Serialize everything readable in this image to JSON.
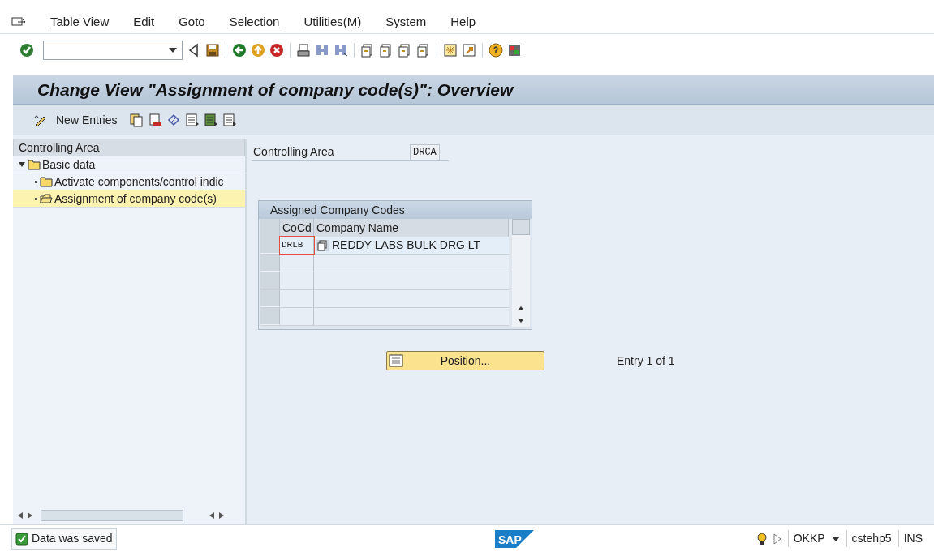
{
  "menu": [
    "Table View",
    "Edit",
    "Goto",
    "Selection",
    "Utilities(M)",
    "System",
    "Help"
  ],
  "title": "Change View \"Assignment of company code(s)\": Overview",
  "app_toolbar": {
    "new_entries": "New Entries"
  },
  "tree": {
    "header": "Controlling Area",
    "items": [
      {
        "label": "Basic data",
        "expanded": true,
        "selected": false,
        "children": [
          {
            "label": "Activate components/control indic",
            "selected": false
          },
          {
            "label": "Assignment of company code(s)",
            "selected": true
          }
        ]
      }
    ]
  },
  "controlling_area": {
    "label": "Controlling Area",
    "value": "DRCA"
  },
  "table": {
    "title": "Assigned Company Codes",
    "columns": [
      "CoCd",
      "Company Name"
    ],
    "rows": [
      {
        "cocd": "DRLB",
        "company_name": "REDDY LABS BULK DRG LT"
      }
    ]
  },
  "position_button": "Position...",
  "entry_info": "Entry 1 of 1",
  "status_bar": {
    "message": {
      "text": "Data was saved"
    },
    "logo": "SAP",
    "transaction": "OKKP",
    "server": "cstehp5",
    "mode": "INS"
  }
}
